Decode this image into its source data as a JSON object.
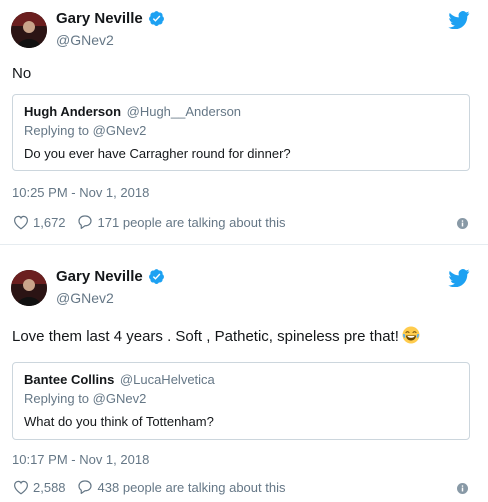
{
  "tweets": [
    {
      "author": {
        "name": "Gary Neville",
        "handle": "@GNev2"
      },
      "text": "No",
      "quote": {
        "name": "Hugh Anderson",
        "handle": "@Hugh__Anderson",
        "replying": "Replying to @GNev2",
        "text": "Do you ever have Carragher round for dinner?"
      },
      "timestamp": "10:25 PM - Nov 1, 2018",
      "likes": "1,672",
      "talking": "171 people are talking about this"
    },
    {
      "author": {
        "name": "Gary Neville",
        "handle": "@GNev2"
      },
      "text": "Love them last 4 years . Soft , Pathetic, spineless pre that!",
      "emoji": "face-with-tears-of-joy",
      "quote": {
        "name": "Bantee Collins",
        "handle": "@LucaHelvetica",
        "replying": "Replying to @GNev2",
        "text": "What do you think of Tottenham?"
      },
      "timestamp": "10:17 PM - Nov 1, 2018",
      "likes": "2,588",
      "talking": "438 people are talking about this"
    }
  ],
  "colors": {
    "twitter_blue": "#1da1f2",
    "secondary_text": "#657786",
    "primary_text": "#14171a",
    "border": "#ccd6dd"
  },
  "icons": [
    "verified-badge-icon",
    "twitter-bird-icon",
    "heart-icon",
    "reply-icon",
    "info-icon"
  ]
}
